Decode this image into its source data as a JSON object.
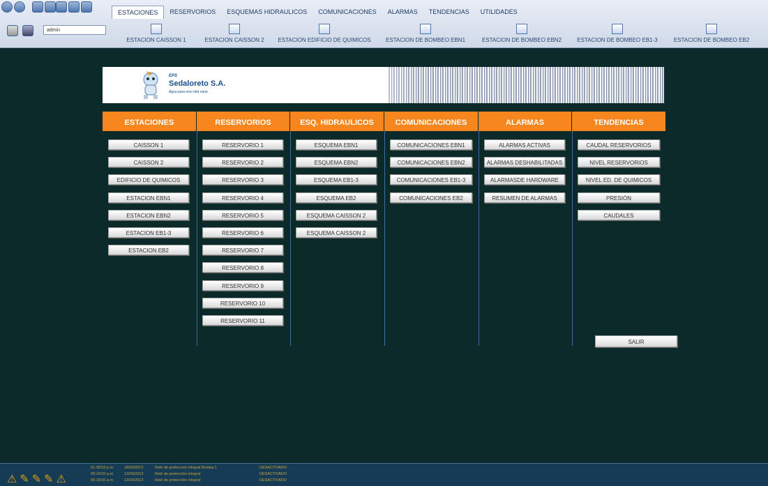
{
  "toolbar": {
    "user": "admin"
  },
  "menu": [
    "ESTACIONES",
    "RESERVORIOS",
    "ESQUEMAS HIDRAULICOS",
    "COMUNICACIONES",
    "ALARMAS",
    "TENDENCIAS",
    "UTILIDADES"
  ],
  "subnav": [
    "ESTACION CAISSON 1",
    "ESTACION CAISSON 2",
    "ESTACION EDIFICIO DE QUIMICOS",
    "ESTACION DE BOMBEO EBN1",
    "ESTACION DE BOMBEO EBN2",
    "ESTACION DE BOMBEO EB1-3",
    "ESTACION DE BOMBEO EB2"
  ],
  "banner": {
    "eps": "EPS",
    "company": "Sedaloreto S.A.",
    "slogan": "Agua para una vida sana"
  },
  "columns": [
    {
      "title": "ESTACIONES",
      "buttons": [
        "CAISSON 1",
        "CAISSON 2",
        "EDIFICIO DE QUIMICOS",
        "ESTACION EBN1",
        "ESTACION EBN2",
        "ESTACION EB1-3",
        "ESTACION EB2"
      ]
    },
    {
      "title": "RESERVORIOS",
      "buttons": [
        "RESERVORIO 1",
        "RESERVORIO 2",
        "RESERVORIO 3",
        "RESERVORIO 4",
        "RESERVORIO 5",
        "RESERVORIO 6",
        "RESERVORIO 7",
        "RESERVORIO 8",
        "RESERVORIO 9",
        "RESERVORIO 10",
        "RESERVORIO 11"
      ]
    },
    {
      "title": "ESQ. HIDRAULICOS",
      "buttons": [
        "ESQUEMA EBN1",
        "ESQUEMA EBN2",
        "ESQUEMA EB1-3",
        "ESQUEMA EB2",
        "ESQUEMA CAISSON 2",
        "ESQUEMA CAISSON 2"
      ]
    },
    {
      "title": "COMUNICACIONES",
      "buttons": [
        "COMUNICACIONES EBN1",
        "COMUNICACIONES EBN2",
        "COMUNICACIONES EB1-3",
        "COMUNICACIONES EB2"
      ]
    },
    {
      "title": "ALARMAS",
      "buttons": [
        "ALARMAS ACTIVAS",
        "ALARMAS DESHABILITADAS",
        "ALARMASDE HARDWARE",
        "RESUMEN DE ALARMAS"
      ]
    },
    {
      "title": "TENDENCIAS",
      "buttons": [
        "CAUDAL RESERVORIOS",
        "NIVEL RESERVORIOS",
        "NIVEL ED. DE QUIMICOS",
        "PRESIÓN",
        "CAUDALES"
      ]
    }
  ],
  "exit_label": "SALIR",
  "alarms": [
    {
      "time": "01:38:53 p.m.",
      "date": "18/03/2012",
      "text": "Relé de protección integral Bomba 1",
      "status": "DESACTIVADO"
    },
    {
      "time": "09:18:00 a.m.",
      "date": "13/03/2012",
      "text": "Relé de protección integral",
      "status": "DESACTIVADO"
    },
    {
      "time": "09:18:00 a.m.",
      "date": "13/03/2012",
      "text": "Relé de protección integral",
      "status": "DESACTIVADO"
    }
  ],
  "colors": {
    "background": "#0d2a2b",
    "header": "#f7861e",
    "divider": "#3a6f9e"
  }
}
